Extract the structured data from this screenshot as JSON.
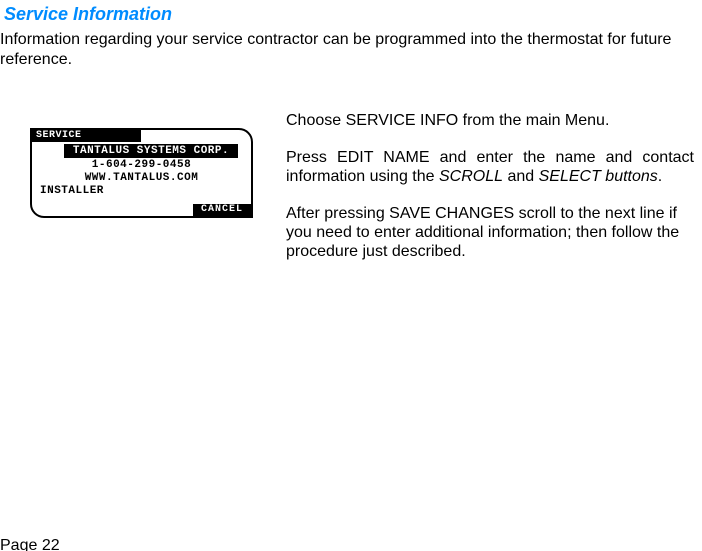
{
  "heading": "Service Information",
  "intro": "Information regarding your service contractor can be programmed into the thermostat for future reference.",
  "figure": {
    "header": "SERVICE",
    "highlight": "TANTALUS SYSTEMS CORP.",
    "phone": "1-604-299-0458",
    "web": "WWW.TANTALUS.COM",
    "installer": "INSTALLER",
    "cancel": "CANCEL"
  },
  "rcol": {
    "p1": "Choose SERVICE INFO from the main Menu.",
    "p2a": "Press EDIT NAME and enter the name and contact information using the ",
    "p2b": "SCROLL",
    "p2c": " and ",
    "p2d": "SELECT buttons",
    "p2e": ".",
    "p3": "After pressing SAVE CHANGES scroll to the next line if you need to enter additional information; then follow the procedure just described."
  },
  "pagefoot": "Page 22"
}
